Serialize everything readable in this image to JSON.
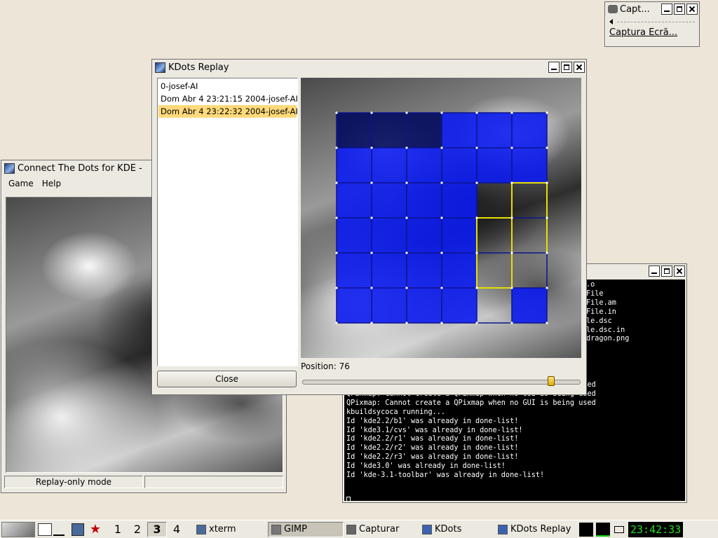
{
  "capture_window": {
    "title": "Capt...",
    "item_label": "Captura Ecrã..."
  },
  "kdots_window": {
    "title": "Connect The Dots for KDE -",
    "menu": [
      "Game",
      "Help"
    ],
    "status_left": "Replay-only mode",
    "status_right": ""
  },
  "terminal": {
    "partial_lines": [
      ".o",
      "File",
      "File.am",
      "File.in",
      "le.dsc",
      "le.dsc.in",
      "dragon.png"
    ],
    "lines": [
      "QPixmap: Cannot create a QPixmap when no GUI is being used",
      "QPixmap: Cannot create a QPixmap when no GUI is being used",
      "QPixmap: Cannot create a QPixmap when no GUI is being used",
      "kbuildsycoca running...",
      "Id 'kde2.2/b1' was already in done-list!",
      "Id 'kde3.1/cvs' was already in done-list!",
      "Id 'kde2.2/r1' was already in done-list!",
      "Id 'kde2.2/r2' was already in done-list!",
      "Id 'kde2.2/r3' was already in done-list!",
      "Id 'kde3.0' was already in done-list!",
      "Id 'kde-3.1-toolbar' was already in done-list!"
    ]
  },
  "replay_window": {
    "title": "KDots Replay",
    "games": [
      "0-josef-AI",
      "Dom Abr 4 23:21:15 2004-josef-AI",
      "Dom Abr 4 23:22:32 2004-josef-AI"
    ],
    "selected_index": 2,
    "close_label": "Close",
    "position_label": "Position: 76",
    "position_value": 76,
    "slider_max": 84
  },
  "board": {
    "rows": 6,
    "cols": 6,
    "cell_fill": [
      [
        "dark",
        "dark",
        "dark",
        "blue",
        "blue",
        "blue"
      ],
      [
        "blue",
        "blue",
        "blue",
        "blue",
        "blue",
        "blue"
      ],
      [
        "blue",
        "blue",
        "blue",
        "blue",
        "none",
        "none"
      ],
      [
        "blue",
        "blue",
        "blue",
        "blue",
        "none",
        "none"
      ],
      [
        "blue",
        "blue",
        "blue",
        "blue",
        "none",
        "none"
      ],
      [
        "blue",
        "blue",
        "blue",
        "blue",
        "none",
        "blue"
      ]
    ],
    "colors": {
      "blue": "#0b1bf0",
      "dark": "#040c5e",
      "line_blue": "#0a1590",
      "line_yellow": "#e6e000"
    }
  },
  "taskbar": {
    "desktops": [
      "1",
      "2",
      "3",
      "4"
    ],
    "active_desktop": 2,
    "tasks": [
      "xterm",
      "GIMP",
      "Capturar",
      "KDots",
      "KDots Replay"
    ],
    "active_task": 1,
    "clock": "23:42:33"
  }
}
